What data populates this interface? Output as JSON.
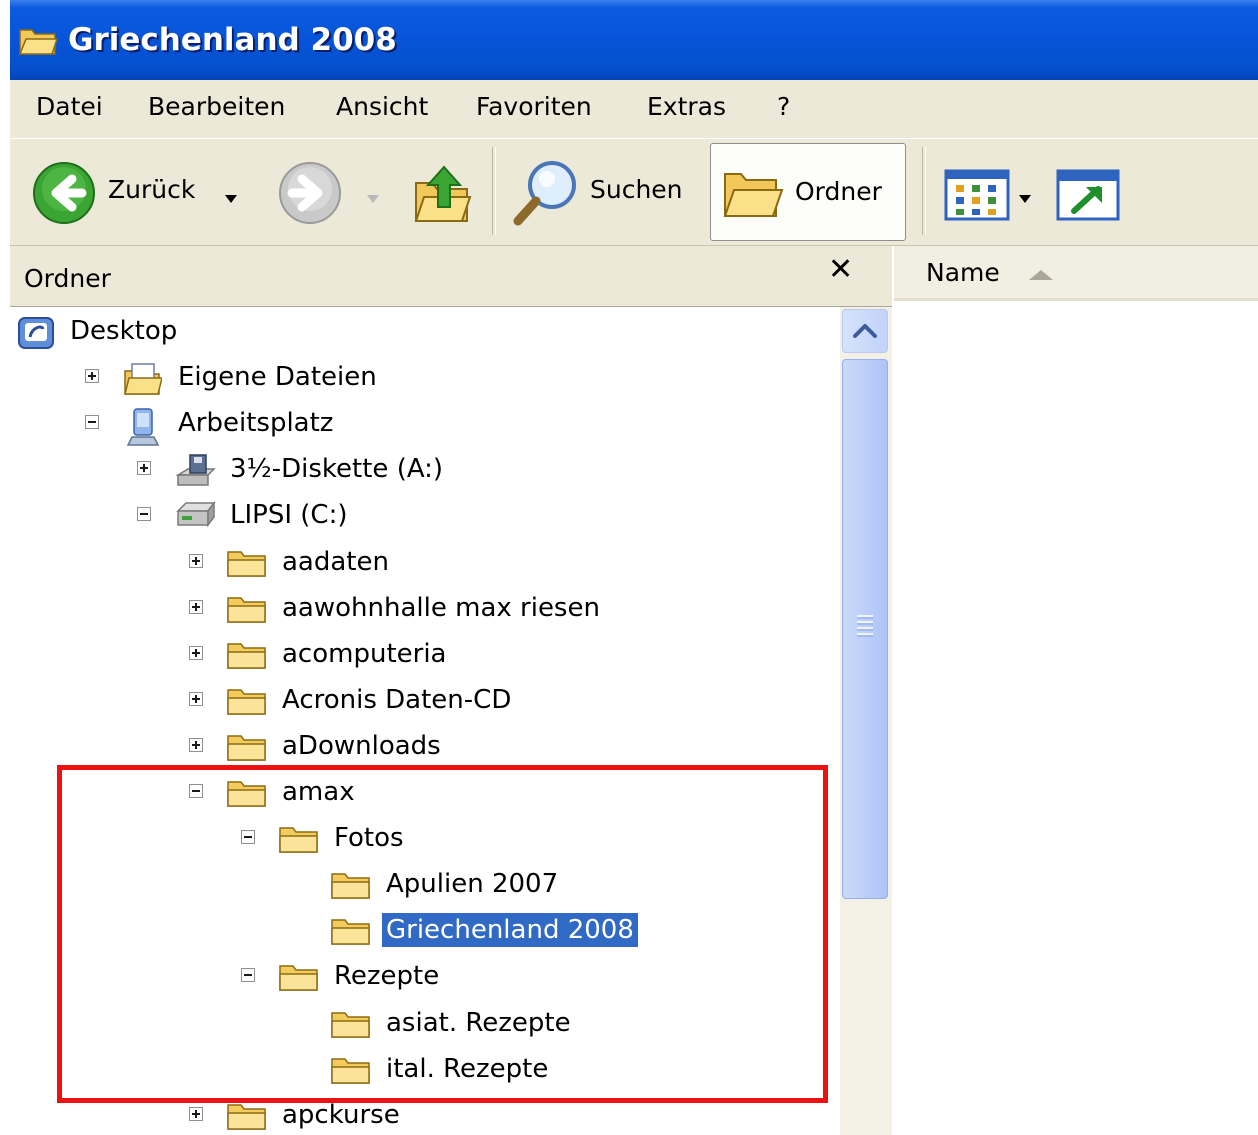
{
  "window": {
    "title": "Griechenland 2008"
  },
  "menu": [
    "Datei",
    "Bearbeiten",
    "Ansicht",
    "Favoriten",
    "Extras",
    "?"
  ],
  "toolbar": {
    "back_label": "Zurück",
    "search_label": "Suchen",
    "folders_label": "Ordner"
  },
  "folder_pane": {
    "title": "Ordner",
    "close_glyph": "✕"
  },
  "content_pane": {
    "column_name": "Name"
  },
  "tree": [
    {
      "label": "Desktop",
      "expander": "none",
      "icon": "desktop-icon"
    },
    {
      "label": "Eigene Dateien",
      "expander": "plus",
      "icon": "my-documents-icon"
    },
    {
      "label": "Arbeitsplatz",
      "expander": "minus",
      "icon": "my-computer-icon"
    },
    {
      "label": "3½-Diskette (A:)",
      "expander": "plus",
      "icon": "floppy-drive-icon"
    },
    {
      "label": "LIPSI (C:)",
      "expander": "minus",
      "icon": "hard-drive-icon"
    },
    {
      "label": "aadaten",
      "expander": "plus",
      "icon": "folder-icon"
    },
    {
      "label": "aawohnhalle max riesen",
      "expander": "plus",
      "icon": "folder-icon"
    },
    {
      "label": "acomputeria",
      "expander": "plus",
      "icon": "folder-icon"
    },
    {
      "label": "Acronis Daten-CD",
      "expander": "plus",
      "icon": "folder-icon"
    },
    {
      "label": "aDownloads",
      "expander": "plus",
      "icon": "folder-icon"
    },
    {
      "label": "amax",
      "expander": "minus",
      "icon": "folder-icon"
    },
    {
      "label": "Fotos",
      "expander": "minus",
      "icon": "folder-icon"
    },
    {
      "label": "Apulien 2007",
      "expander": "none",
      "icon": "folder-icon"
    },
    {
      "label": "Griechenland 2008",
      "expander": "none",
      "icon": "folder-icon",
      "selected": true
    },
    {
      "label": "Rezepte",
      "expander": "minus",
      "icon": "folder-icon"
    },
    {
      "label": "asiat. Rezepte",
      "expander": "none",
      "icon": "folder-icon"
    },
    {
      "label": "ital. Rezepte",
      "expander": "none",
      "icon": "folder-icon"
    },
    {
      "label": "apckurse",
      "expander": "plus",
      "icon": "folder-icon"
    }
  ],
  "colors": {
    "titlebar": "#0754d8",
    "chrome": "#ece9d8",
    "selection": "#316ac5",
    "highlight_box": "#ee1111"
  }
}
